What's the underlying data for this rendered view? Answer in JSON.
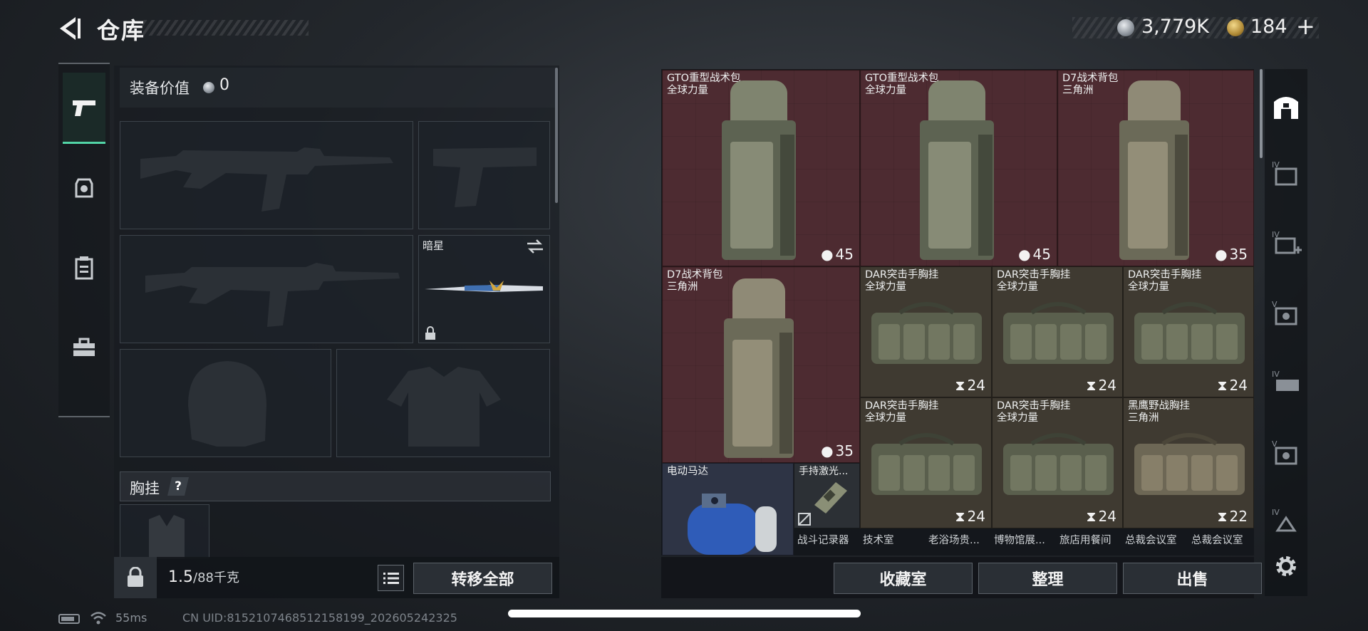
{
  "header": {
    "title": "仓库",
    "money": "3,779K",
    "gold": "184",
    "add_symbol": "+"
  },
  "loadout": {
    "equip_value_label": "装备价值",
    "equip_value": "0",
    "knife_name": "暗星",
    "chest_rig_label": "胸挂",
    "chest_rig_help": "?",
    "weight": "1.5",
    "weight_max": "/88千克",
    "transfer_all": "转移全部"
  },
  "storage": {
    "items": [
      {
        "name": "GTO重型战术包",
        "source": "全球力量",
        "capacity": "45",
        "color": "red"
      },
      {
        "name": "GTO重型战术包",
        "source": "全球力量",
        "capacity": "45",
        "color": "red"
      },
      {
        "name": "D7战术背包",
        "source": "三角洲",
        "capacity": "35",
        "color": "red"
      },
      {
        "name": "D7战术背包",
        "source": "三角洲",
        "capacity": "35",
        "color": "red"
      },
      {
        "name": "DAR突击手胸挂",
        "source": "全球力量",
        "capacity": "24",
        "color": "olive"
      },
      {
        "name": "DAR突击手胸挂",
        "source": "全球力量",
        "capacity": "24",
        "color": "olive"
      },
      {
        "name": "DAR突击手胸挂",
        "source": "全球力量",
        "capacity": "24",
        "color": "olive"
      },
      {
        "name": "DAR突击手胸挂",
        "source": "全球力量",
        "capacity": "24",
        "color": "olive"
      },
      {
        "name": "DAR突击手胸挂",
        "source": "全球力量",
        "capacity": "24",
        "color": "olive"
      },
      {
        "name": "黑鹰野战胸挂",
        "source": "三角洲",
        "capacity": "22",
        "color": "olive"
      },
      {
        "name": "电动马达",
        "source": "",
        "capacity": "",
        "color": "blue"
      },
      {
        "name": "手持激光...",
        "source": "",
        "capacity": "",
        "color": "grey"
      }
    ],
    "bottom_labels": [
      "战斗记录器",
      "技术室",
      "老浴场贵...",
      "博物馆展...",
      "旅店用餐间",
      "总裁会议室",
      "总裁会议室"
    ],
    "buttons": {
      "collection": "收藏室",
      "organize": "整理",
      "sell": "出售"
    }
  },
  "status": {
    "ping": "55ms",
    "uid": "CN UID:8152107468512158199_202605242325"
  },
  "colors": {
    "accent": "#52d4a6",
    "red_cell": "#4d2b31",
    "olive_cell": "#3f3a31",
    "blue_cell": "#2e3445"
  },
  "icons": {
    "nav": [
      "pistol-icon",
      "helmet-armor-icon",
      "chest-rig-icon",
      "toolbox-icon"
    ],
    "right_tabs": [
      "storage-home-icon",
      "storage-tab-4-icon",
      "storage-tab-4-add-icon",
      "storage-tab-5-icon",
      "storage-tab-4b-icon",
      "storage-tab-5b-icon",
      "storage-tab-4c-icon",
      "settings-gear-icon"
    ]
  }
}
